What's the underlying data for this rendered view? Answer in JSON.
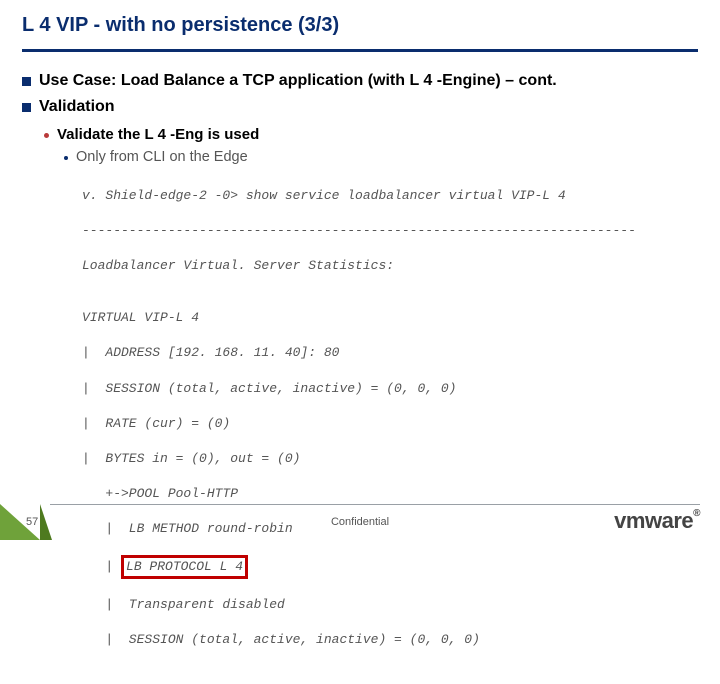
{
  "title": "L 4 VIP - with no persistence (3/3)",
  "bullets": {
    "b1": "Use Case: Load Balance a TCP application (with L 4 -Engine) – cont.",
    "b2": "Validation",
    "b3": "Validate the L 4 -Eng is used",
    "b4": "Only from CLI on the Edge"
  },
  "code": {
    "l0": "v. Shield-edge-2 -0> show service loadbalancer virtual VIP-L 4",
    "l1": "-----------------------------------------------------------------------",
    "l2": "Loadbalancer Virtual. Server Statistics:",
    "l3": "",
    "l4": "VIRTUAL VIP-L 4",
    "l5": "|  ADDRESS [192. 168. 11. 40]: 80",
    "l6": "|  SESSION (total, active, inactive) = (0, 0, 0)",
    "l7": "|  RATE (cur) = (0)",
    "l8": "|  BYTES in = (0), out = (0)",
    "l9": "   +->POOL Pool-HTTP",
    "l10": "   |  LB METHOD round-robin",
    "l11_prefix": "   | ",
    "l11_box": "LB PROTOCOL L 4",
    "l12": "   |  Transparent disabled",
    "l13": "   |  SESSION (total, active, inactive) = (0, 0, 0)"
  },
  "footer": {
    "page": "57",
    "conf": "Confidential",
    "logo": "vmware"
  }
}
